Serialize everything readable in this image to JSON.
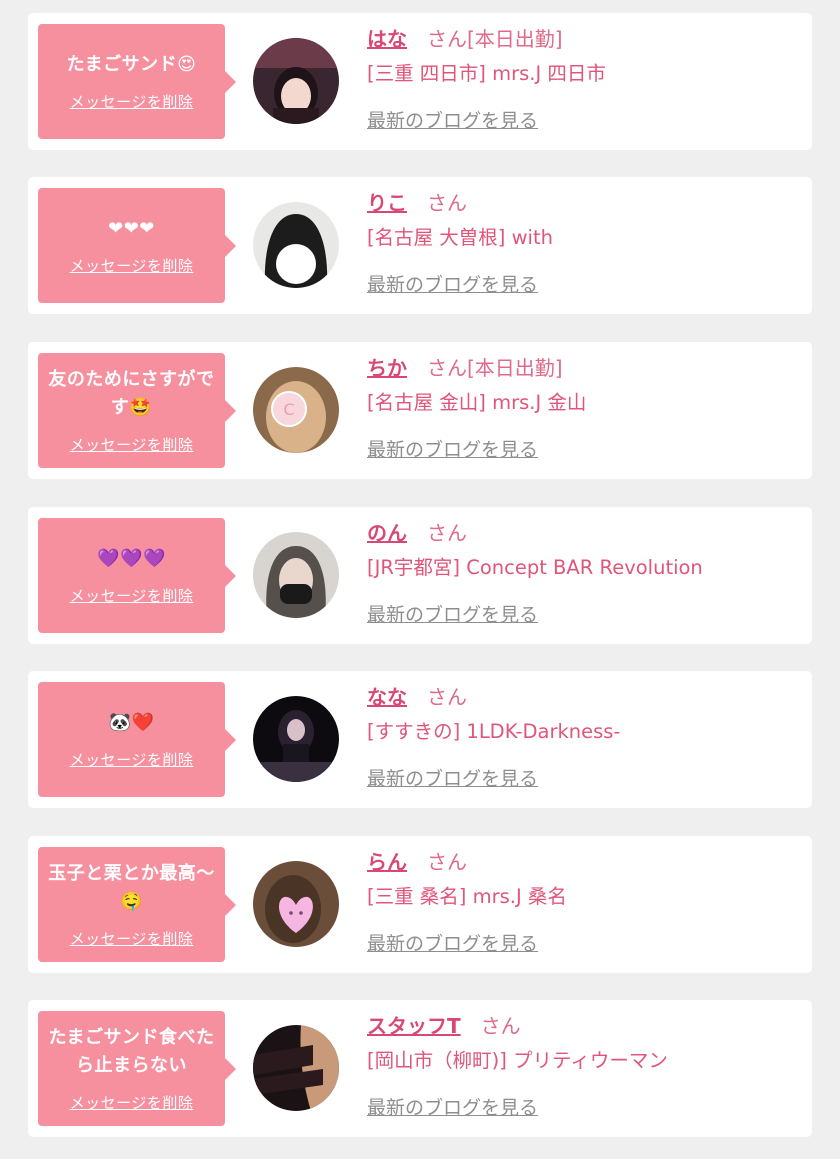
{
  "delete_label": "メッセージを削除",
  "blog_label": "最新のブログを見る",
  "honorific": "さん",
  "colors": {
    "accent": "#f6909f",
    "name": "#d94874",
    "text": "#e0557a",
    "link_gray": "#8e8e8e"
  },
  "entries": [
    {
      "message": "たまごサンド😍",
      "name": "はな",
      "status": "[本日出勤]",
      "shop": "[三重 四日市] mrs.J 四日市"
    },
    {
      "message": "❤❤❤",
      "name": "りこ",
      "status": "",
      "shop": "[名古屋 大曽根] with"
    },
    {
      "message": "友のためにさすがです🤩",
      "name": "ちか",
      "status": "[本日出勤]",
      "shop": "[名古屋 金山] mrs.J 金山"
    },
    {
      "message": "💜💜💜",
      "name": "のん",
      "status": "",
      "shop": "[JR宇都宮] Concept BAR Revolution"
    },
    {
      "message": "🐼❤️",
      "name": "なな",
      "status": "",
      "shop": "[すすきの] 1LDK-Darkness-"
    },
    {
      "message": "玉子と栗とか最高〜🤤",
      "name": "らん",
      "status": "",
      "shop": "[三重 桑名] mrs.J 桑名"
    },
    {
      "message": "たまごサンド食べたら止まらない",
      "name": "スタッフT",
      "status": "",
      "shop": "[岡山市（柳町)] プリティウーマン"
    }
  ]
}
